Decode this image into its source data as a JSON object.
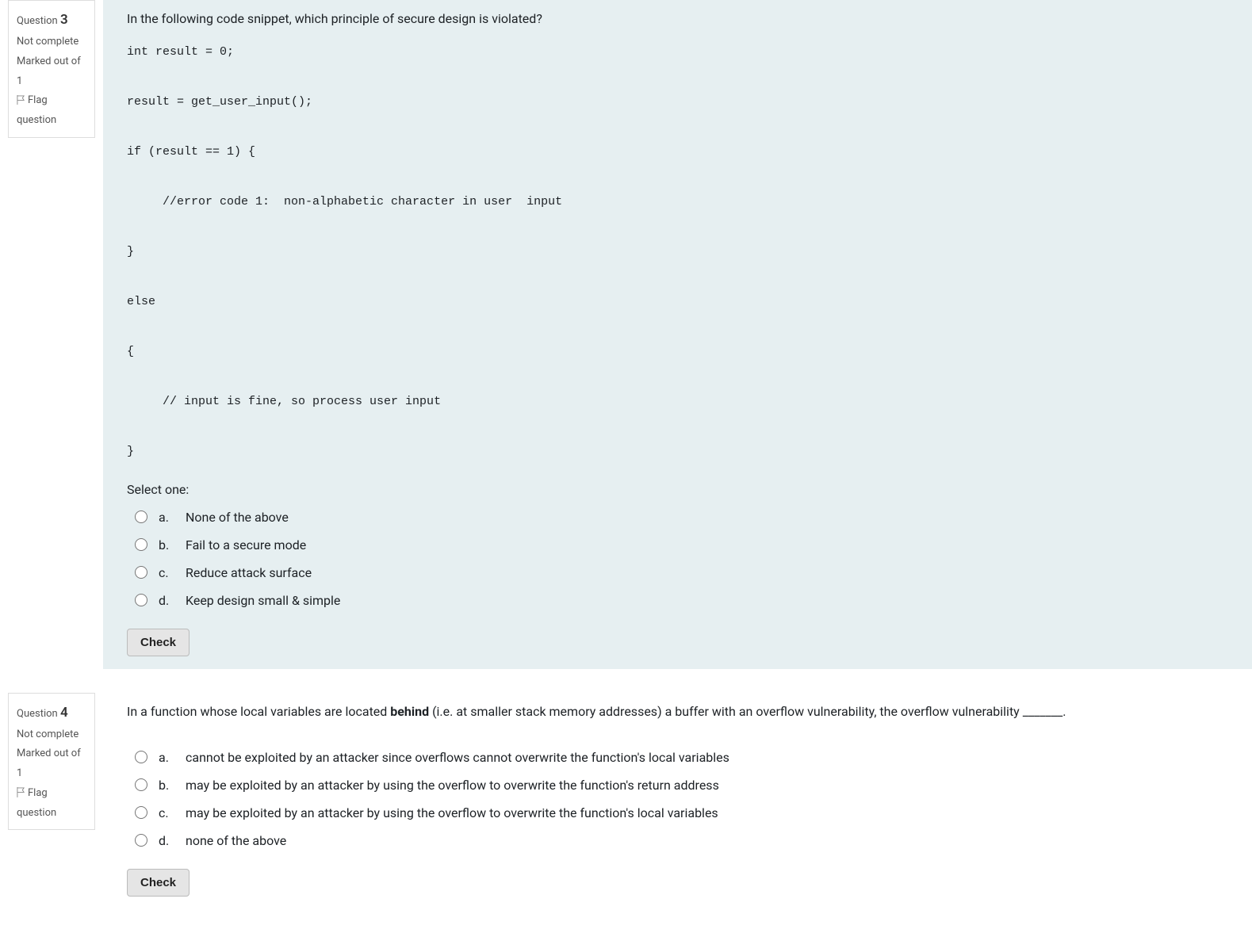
{
  "q3": {
    "info": {
      "label": "Question",
      "number": "3",
      "state": "Not complete",
      "grade": "Marked out of 1",
      "flag": "Flag question"
    },
    "qtext": "In the following code snippet, which principle of secure design is violated?",
    "code": "int result = 0;\n\nresult = get_user_input();\n\nif (result == 1) {\n\n     //error code 1:  non-alphabetic character in user  input\n\n}\n\nelse\n\n{\n\n     // input is fine, so process user input\n\n}",
    "prompt": "Select one:",
    "options": {
      "a": {
        "letter": "a.",
        "text": "None of the above"
      },
      "b": {
        "letter": "b.",
        "text": "Fail to a secure mode"
      },
      "c": {
        "letter": "c.",
        "text": "Reduce attack surface"
      },
      "d": {
        "letter": "d.",
        "text": "Keep design small & simple"
      }
    },
    "check": "Check"
  },
  "q4": {
    "info": {
      "label": "Question",
      "number": "4",
      "state": "Not complete",
      "grade": "Marked out of 1",
      "flag": "Flag question"
    },
    "qtext_pre": "In a function whose local variables are located ",
    "qtext_bold": "behind",
    "qtext_post": " (i.e. at smaller stack memory addresses) a buffer with an overflow vulnerability, the overflow vulnerability _______.",
    "options": {
      "a": {
        "letter": "a.",
        "text": "cannot be exploited by an attacker since overflows cannot overwrite the function's local variables"
      },
      "b": {
        "letter": "b.",
        "text": "may be exploited by an attacker by using the overflow to overwrite the function's return address"
      },
      "c": {
        "letter": "c.",
        "text": "may be exploited by an attacker by using the overflow to overwrite the function's local variables"
      },
      "d": {
        "letter": "d.",
        "text": "none of the above"
      }
    },
    "check": "Check"
  }
}
